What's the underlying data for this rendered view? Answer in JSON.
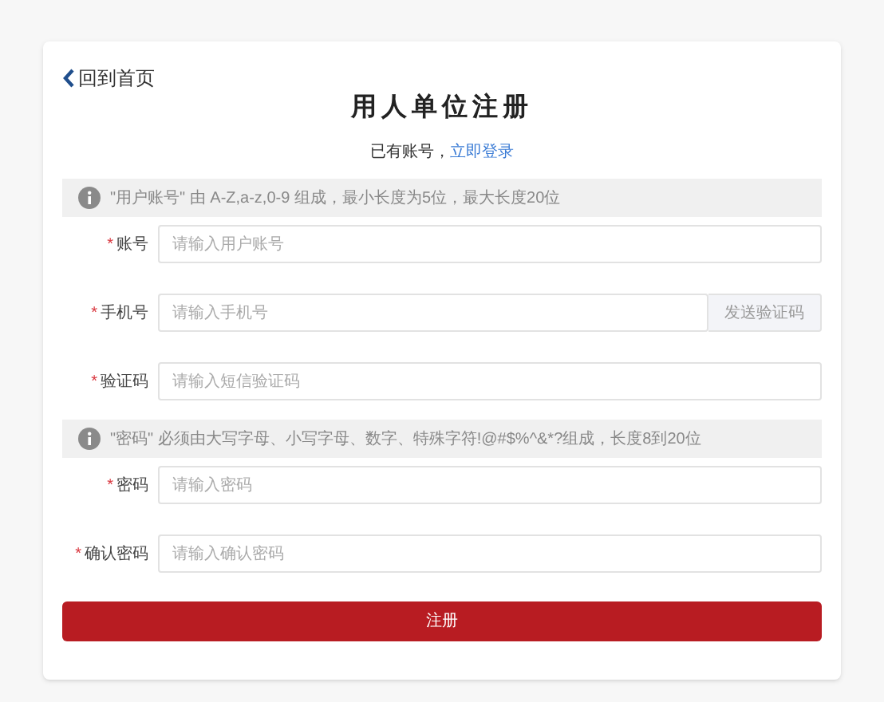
{
  "back_link": {
    "label": "回到首页"
  },
  "title": "用人单位注册",
  "login_prompt": {
    "text": "已有账号，",
    "link": "立即登录"
  },
  "sections": [
    {
      "notice": "\"用户账号\" 由 A-Z,a-z,0-9 组成，最小长度为5位，最大长度20位",
      "fields": [
        {
          "mark": "*",
          "label": "账号",
          "placeholder": "请输入用户账号"
        },
        {
          "mark": "*",
          "label": "手机号",
          "placeholder": "请输入手机号",
          "button": "发送验证码"
        },
        {
          "mark": "*",
          "label": "验证码",
          "placeholder": "请输入短信验证码"
        }
      ]
    },
    {
      "notice": "\"密码\" 必须由大写字母、小写字母、数字、特殊字符!@#$%^&*?组成，长度8到20位",
      "fields": [
        {
          "mark": "*",
          "label": "密码",
          "placeholder": "请输入密码"
        },
        {
          "mark": "*",
          "label": "确认密码",
          "placeholder": "请输入确认密码"
        }
      ]
    }
  ],
  "submit": "注册"
}
